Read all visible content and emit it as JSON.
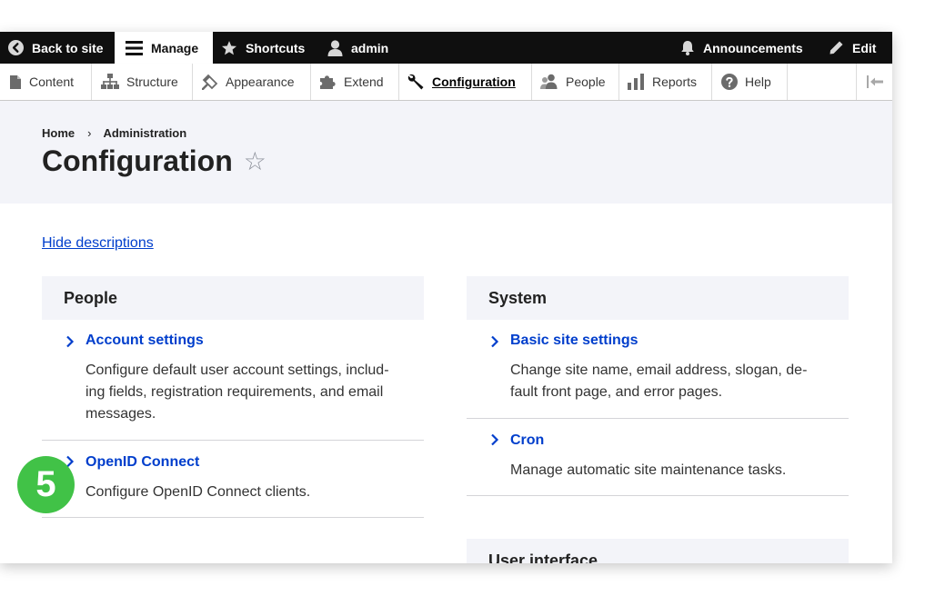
{
  "toolbar": {
    "back_to_site": "Back to site",
    "manage": "Manage",
    "shortcuts": "Shortcuts",
    "user": "admin",
    "announcements": "Announcements",
    "edit": "Edit"
  },
  "tray": {
    "items": [
      {
        "label": "Content",
        "icon": "file-icon"
      },
      {
        "label": "Structure",
        "icon": "sitemap-icon"
      },
      {
        "label": "Appearance",
        "icon": "paintbrush-icon"
      },
      {
        "label": "Extend",
        "icon": "puzzle-icon"
      },
      {
        "label": "Configuration",
        "icon": "wrench-icon",
        "active": true
      },
      {
        "label": "People",
        "icon": "people-icon"
      },
      {
        "label": "Reports",
        "icon": "bar-chart-icon"
      },
      {
        "label": "Help",
        "icon": "help-icon"
      }
    ]
  },
  "breadcrumb": {
    "home": "Home",
    "separator": "›",
    "current": "Administration"
  },
  "page": {
    "title": "Configuration",
    "star": "☆"
  },
  "hide_descriptions": "Hide descriptions",
  "panels": {
    "people": {
      "title": "People",
      "entries": [
        {
          "title": "Account settings",
          "description_lines": [
            "Configure default user account settings, includ-",
            "ing fields, registration requirements, and email",
            "messages."
          ]
        },
        {
          "title": "OpenID Connect",
          "description_lines": [
            "Configure OpenID Connect clients."
          ]
        }
      ]
    },
    "system": {
      "title": "System",
      "entries": [
        {
          "title": "Basic site settings",
          "description_lines": [
            "Change site name, email address, slogan, de-",
            "fault front page, and error pages."
          ]
        },
        {
          "title": "Cron",
          "description_lines": [
            "Manage automatic site maintenance tasks."
          ]
        }
      ]
    },
    "user_interface": {
      "title": "User interface"
    }
  },
  "step_badge": "5",
  "colors": {
    "toolbar_bg": "#0f0f0f",
    "link": "#003ecc",
    "panel_head_bg": "#f3f4f9",
    "badge": "#41c247"
  }
}
